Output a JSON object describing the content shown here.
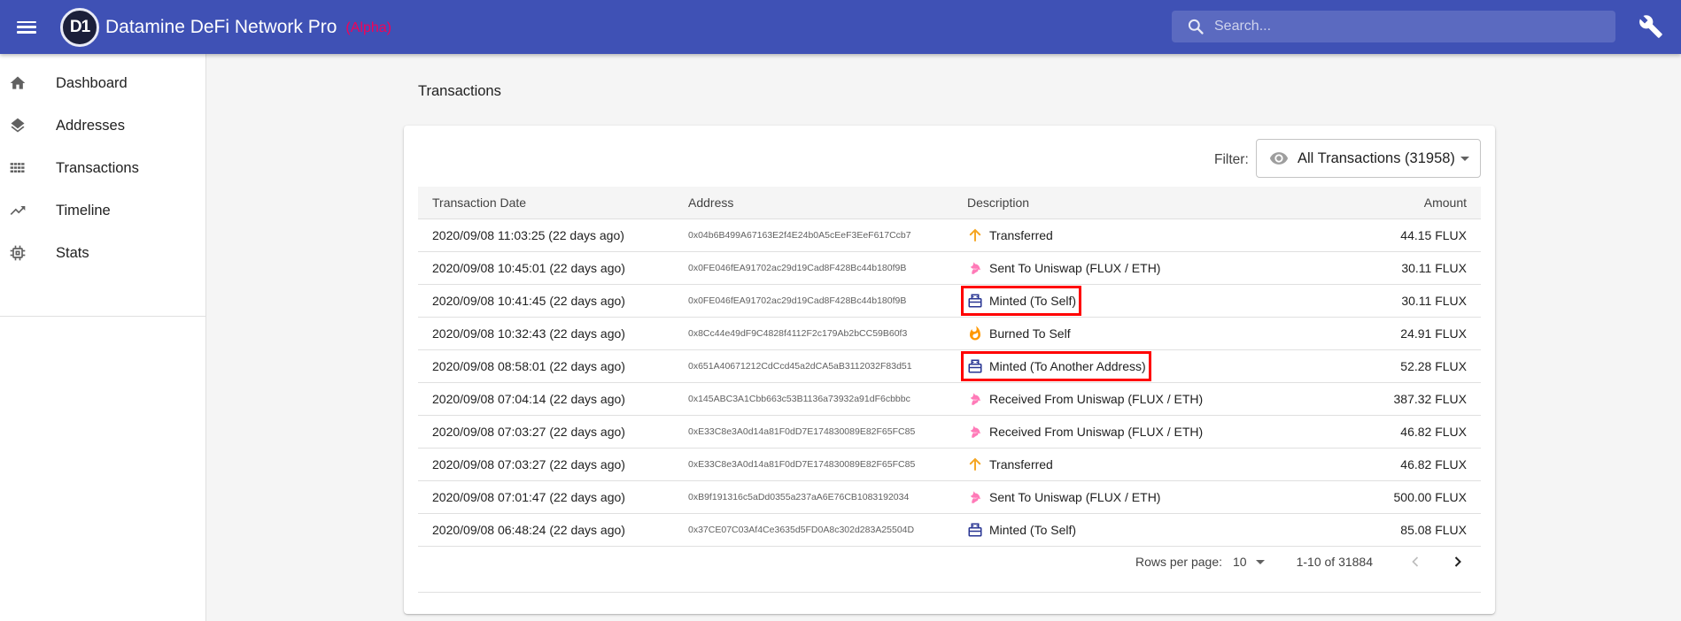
{
  "app": {
    "title": "Datamine DeFi Network Pro",
    "tag": "(Alpha)",
    "logo_text": "D1",
    "brand_color": "#3f51b5",
    "tag_color": "#f50057"
  },
  "search": {
    "placeholder": "Search..."
  },
  "sidebar": {
    "items": [
      {
        "label": "Dashboard",
        "icon": "home-icon"
      },
      {
        "label": "Addresses",
        "icon": "layers-icon"
      },
      {
        "label": "Transactions",
        "icon": "grid-icon"
      },
      {
        "label": "Timeline",
        "icon": "trending-up-icon"
      },
      {
        "label": "Stats",
        "icon": "chip-icon"
      }
    ]
  },
  "page": {
    "heading": "Transactions"
  },
  "filter": {
    "label": "Filter:",
    "value": "All Transactions (31958)"
  },
  "table": {
    "headers": [
      "Transaction Date",
      "Address",
      "Description",
      "Amount"
    ],
    "rows": [
      {
        "date": "2020/09/08 11:03:25 (22 days ago)",
        "address": "0x04b6B499A67163E2f4E24b0A5cEeF3EeF617Ccb7",
        "description": "Transferred",
        "icon": "arrow-up-icon",
        "amount": "44.15 FLUX",
        "highlighted": false
      },
      {
        "date": "2020/09/08 10:45:01 (22 days ago)",
        "address": "0x0FE046fEA91702ac29d19Cad8F428Bc44b180f9B",
        "description": "Sent To Uniswap (FLUX / ETH)",
        "icon": "unicorn-icon",
        "amount": "30.11 FLUX",
        "highlighted": false
      },
      {
        "date": "2020/09/08 10:41:45 (22 days ago)",
        "address": "0x0FE046fEA91702ac29d19Cad8F428Bc44b180f9B",
        "description": "Minted (To Self)",
        "icon": "mint-icon",
        "amount": "30.11 FLUX",
        "highlighted": true
      },
      {
        "date": "2020/09/08 10:32:43 (22 days ago)",
        "address": "0x8Cc44e49dF9C4828f4112F2c179Ab2bCC59B60f3",
        "description": "Burned To Self",
        "icon": "fire-icon",
        "amount": "24.91 FLUX",
        "highlighted": false
      },
      {
        "date": "2020/09/08 08:58:01 (22 days ago)",
        "address": "0x651A40671212CdCcd45a2dCA5aB3112032F83d51",
        "description": "Minted (To Another Address)",
        "icon": "mint-icon",
        "amount": "52.28 FLUX",
        "highlighted": true
      },
      {
        "date": "2020/09/08 07:04:14 (22 days ago)",
        "address": "0x145ABC3A1Cbb663c53B1136a73932a91dF6cbbbc",
        "description": "Received From Uniswap (FLUX / ETH)",
        "icon": "unicorn-icon",
        "amount": "387.32 FLUX",
        "highlighted": false
      },
      {
        "date": "2020/09/08 07:03:27 (22 days ago)",
        "address": "0xE33C8e3A0d14a81F0dD7E174830089E82F65FC85",
        "description": "Received From Uniswap (FLUX / ETH)",
        "icon": "unicorn-icon",
        "amount": "46.82 FLUX",
        "highlighted": false
      },
      {
        "date": "2020/09/08 07:03:27 (22 days ago)",
        "address": "0xE33C8e3A0d14a81F0dD7E174830089E82F65FC85",
        "description": "Transferred",
        "icon": "arrow-up-icon",
        "amount": "46.82 FLUX",
        "highlighted": false
      },
      {
        "date": "2020/09/08 07:01:47 (22 days ago)",
        "address": "0xB9f191316c5aDd0355a237aA6E76CB1083192034",
        "description": "Sent To Uniswap (FLUX / ETH)",
        "icon": "unicorn-icon",
        "amount": "500.00 FLUX",
        "highlighted": false
      },
      {
        "date": "2020/09/08 06:48:24 (22 days ago)",
        "address": "0x37CE07C03Af4Ce3635d5FD0A8c302d283A25504D",
        "description": "Minted (To Self)",
        "icon": "mint-icon",
        "amount": "85.08 FLUX",
        "highlighted": false
      }
    ]
  },
  "pagination": {
    "rows_label": "Rows per page:",
    "rows_value": "10",
    "range": "1-10 of 31884"
  }
}
